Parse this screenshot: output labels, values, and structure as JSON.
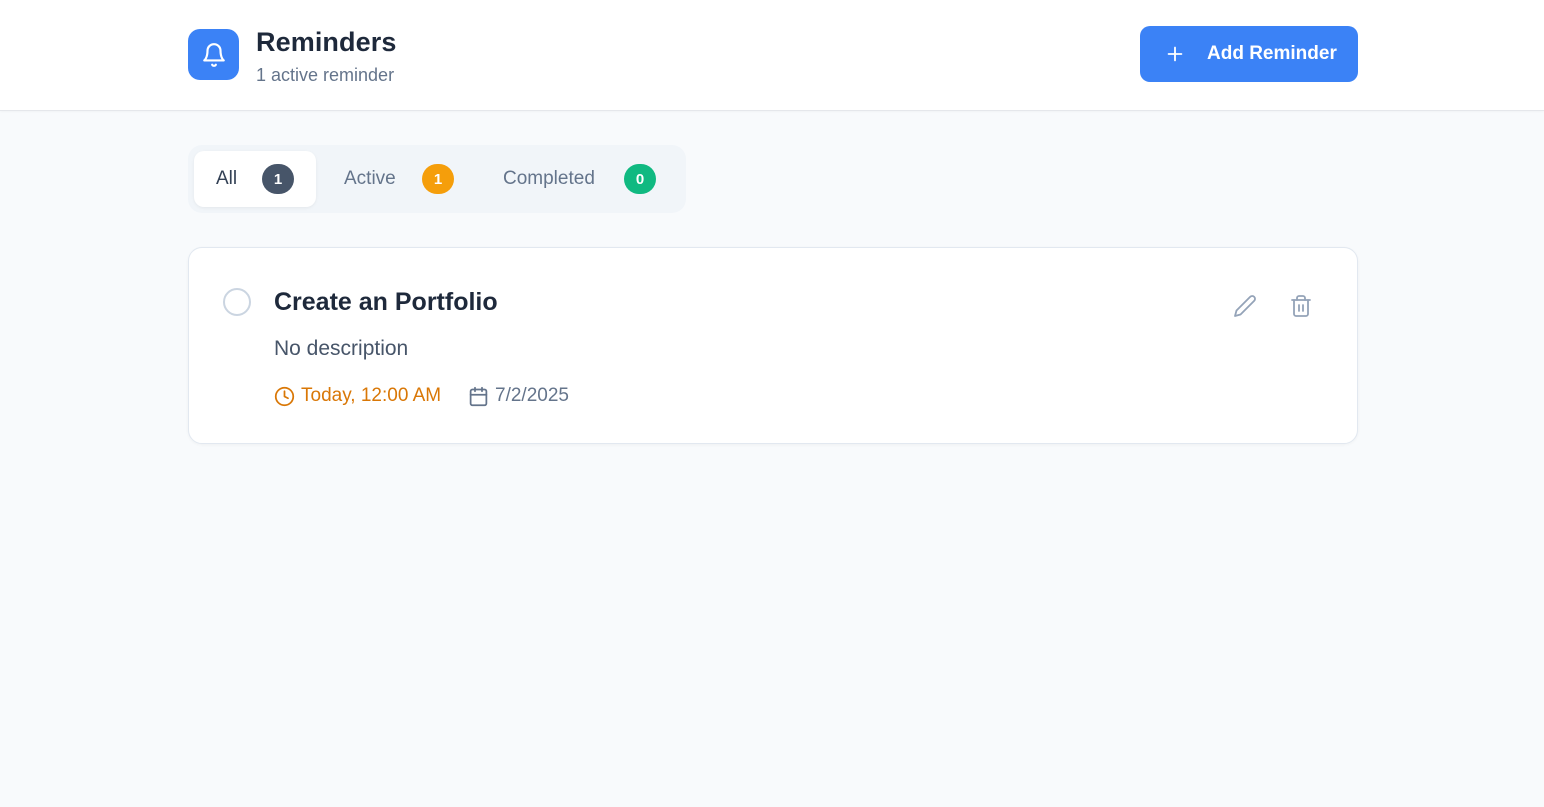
{
  "header": {
    "title": "Reminders",
    "subtitle": "1 active reminder",
    "logo_icon": "bell-icon",
    "add_button_label": "Add Reminder",
    "add_button_icon": "plus-icon",
    "accent_color": "#3b82f6"
  },
  "tabs": [
    {
      "label": "All",
      "count": "1",
      "badge_color": "#475569",
      "selected": true
    },
    {
      "label": "Active",
      "count": "1",
      "badge_color": "#f59e0b",
      "selected": false
    },
    {
      "label": "Completed",
      "count": "0",
      "badge_color": "#10b981",
      "selected": false
    }
  ],
  "reminders": [
    {
      "title": "Create an Portfolio",
      "description": "No description",
      "time": "Today, 12:00 AM",
      "time_icon": "clock-icon",
      "time_color": "#d97706",
      "date": "7/2/2025",
      "date_icon": "calendar-icon",
      "completed": false,
      "actions": [
        "pencil-icon",
        "trash-icon"
      ]
    }
  ]
}
